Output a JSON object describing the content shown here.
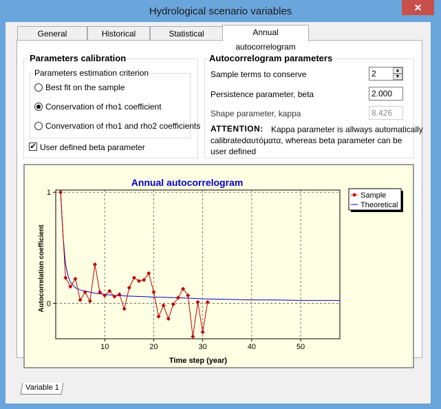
{
  "window": {
    "title": "Hydrological scenario variables",
    "close_glyph": "✕"
  },
  "tabs": [
    {
      "label": "General information"
    },
    {
      "label": "Historical sample"
    },
    {
      "label": "Statistical properties"
    },
    {
      "label": "Annual autocorrelogram",
      "active": true
    }
  ],
  "calibration": {
    "title": "Parameters calibration",
    "criterion_title": "Parameters estimation criterion",
    "options": [
      {
        "label": "Best fit on the sample",
        "selected": false
      },
      {
        "label": "Conservation of rho1 coefficient",
        "selected": true
      },
      {
        "label": "Convervation of rho1 and rho2 coefficients",
        "selected": false
      }
    ],
    "user_defined_beta": {
      "label": "User defined beta parameter",
      "checked": true
    }
  },
  "autocorrelogram_params": {
    "title": "Autocorrelogram parameters",
    "sample_terms": {
      "label": "Sample terms to conserve",
      "value": "2"
    },
    "beta": {
      "label": "Persistence parameter, beta",
      "value": "2.000"
    },
    "kappa": {
      "label": "Shape parameter, kappa",
      "value": "8.426"
    },
    "attention_title": "ATTENTION:",
    "attention_lines": [
      "Kappa parameter is allways automatically",
      "calibratedαυτόματα, whereas beta parameter can be",
      "user defined"
    ]
  },
  "chart_data": {
    "type": "line",
    "title": "Annual autocorrelogram",
    "xlabel": "Time step (year)",
    "ylabel": "Autocorrelation coefficient",
    "xlim": [
      0,
      58
    ],
    "ylim": [
      -0.32,
      1.02
    ],
    "xticks": [
      10,
      20,
      30,
      40,
      50
    ],
    "yticks": [
      0,
      1
    ],
    "grid": true,
    "legend": "top-right",
    "series": [
      {
        "name": "Sample",
        "color": "#c00000",
        "x": [
          1,
          2,
          3,
          4,
          5,
          6,
          7,
          8,
          9,
          10,
          11,
          12,
          13,
          14,
          15,
          16,
          17,
          18,
          19,
          20,
          21,
          22,
          23,
          24,
          25,
          26,
          27,
          28,
          29,
          30,
          31
        ],
        "y": [
          1.0,
          0.23,
          0.15,
          0.22,
          0.03,
          0.1,
          0.02,
          0.35,
          0.1,
          0.07,
          0.11,
          0.06,
          0.08,
          -0.05,
          0.14,
          0.23,
          0.2,
          0.21,
          0.27,
          0.1,
          -0.12,
          -0.02,
          -0.14,
          -0.01,
          0.05,
          0.13,
          0.07,
          -0.3,
          0.01,
          -0.26,
          0.01
        ]
      },
      {
        "name": "Theoretical",
        "color": "#0000cc",
        "x": [
          1,
          1.5,
          2,
          2.5,
          3,
          4,
          5,
          6,
          7,
          8,
          10,
          12,
          15,
          18,
          20,
          25,
          30,
          35,
          40,
          45,
          50,
          55,
          58
        ],
        "y": [
          1.0,
          0.6,
          0.35,
          0.25,
          0.19,
          0.14,
          0.12,
          0.11,
          0.1,
          0.09,
          0.08,
          0.07,
          0.065,
          0.06,
          0.055,
          0.05,
          0.04,
          0.035,
          0.03,
          0.03,
          0.025,
          0.025,
          0.025
        ]
      }
    ]
  },
  "bottom_tab": {
    "label": "Variable 1"
  }
}
